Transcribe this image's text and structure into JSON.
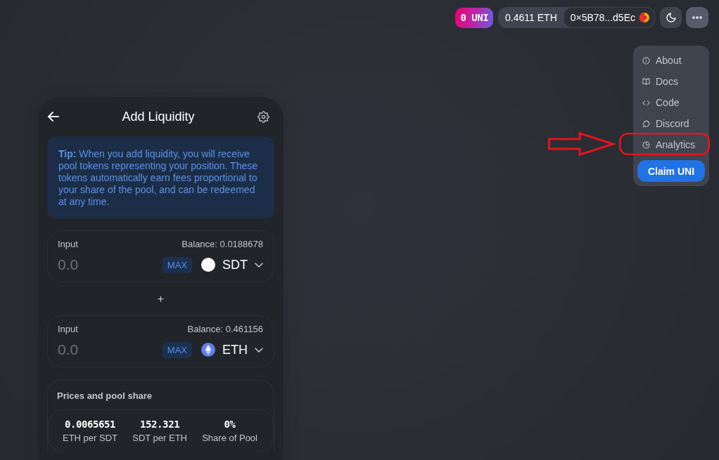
{
  "header": {
    "uni_balance": "0 UNI",
    "eth_balance": "0.4611 ETH",
    "account": "0×5B78...d5Ec"
  },
  "menu": {
    "open": true,
    "items": [
      {
        "kind": "info",
        "label": "About",
        "highlighted": false
      },
      {
        "kind": "book",
        "label": "Docs",
        "highlighted": false
      },
      {
        "kind": "code",
        "label": "Code",
        "highlighted": false
      },
      {
        "kind": "chat",
        "label": "Discord",
        "highlighted": false
      },
      {
        "kind": "pie",
        "label": "Analytics",
        "highlighted": true
      }
    ],
    "claim_button": "Claim UNI"
  },
  "card": {
    "title": "Add Liquidity",
    "tip": "**Tip:** When you add liquidity, you will receive pool tokens representing your position. These tokens automatically earn fees proportional to your share of the pool, and can be redeemed at any time.",
    "inputs": [
      {
        "kind": "plain",
        "label": "Input",
        "balance": "Balance: 0.0188678",
        "placeholder": "0.0",
        "max_button": "MAX",
        "token": "SDT"
      },
      {
        "kind": "diamond",
        "label": "Input",
        "balance": "Balance: 0.461156",
        "placeholder": "0.0",
        "max_button": "MAX",
        "token": "ETH"
      }
    ],
    "separator": "+",
    "prices": {
      "title": "Prices and pool share",
      "items": [
        {
          "value": "0.0065651",
          "label": "ETH per SDT"
        },
        {
          "value": "152.321",
          "label": "SDT per ETH"
        },
        {
          "value": "0%",
          "label": "Share of Pool"
        }
      ]
    }
  }
}
